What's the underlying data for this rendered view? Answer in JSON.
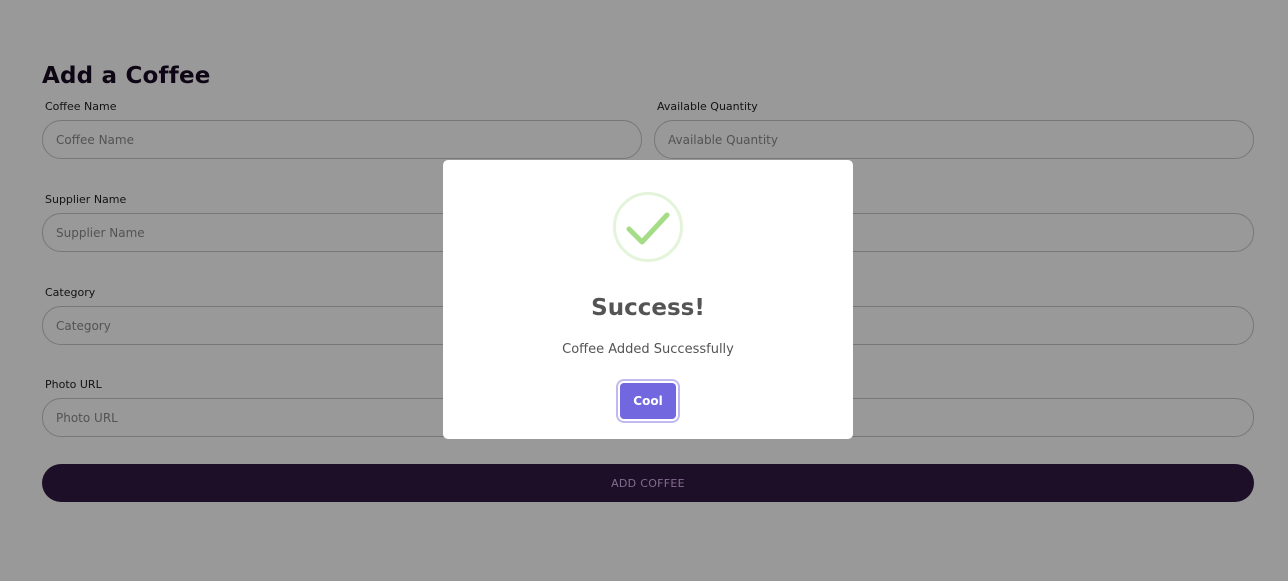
{
  "form": {
    "title": "Add a Coffee",
    "fields": [
      {
        "label": "Coffee Name",
        "placeholder": "Coffee Name",
        "value": ""
      },
      {
        "label": "Available Quantity",
        "placeholder": "Available Quantity",
        "value": ""
      },
      {
        "label": "Supplier Name",
        "placeholder": "Supplier Name",
        "value": ""
      },
      {
        "label": "",
        "placeholder": "",
        "value": ""
      },
      {
        "label": "Category",
        "placeholder": "Category",
        "value": ""
      },
      {
        "label": "",
        "placeholder": "",
        "value": ""
      },
      {
        "label": "Photo URL",
        "placeholder": "Photo URL",
        "value": ""
      },
      {
        "label": "",
        "placeholder": "",
        "value": ""
      }
    ],
    "submit_label": "Add Coffee"
  },
  "modal": {
    "icon": "checkmark-icon",
    "title": "Success!",
    "text": "Coffee Added Successfully",
    "confirm_label": "Cool"
  },
  "colors": {
    "title": "#1a0b24",
    "submit_background": "#331a43",
    "submit_text": "#d9b2f0",
    "success_icon": "#a5dc86",
    "confirm_button": "#7367e0",
    "overlay": "rgba(0,0,0,0.4)"
  }
}
